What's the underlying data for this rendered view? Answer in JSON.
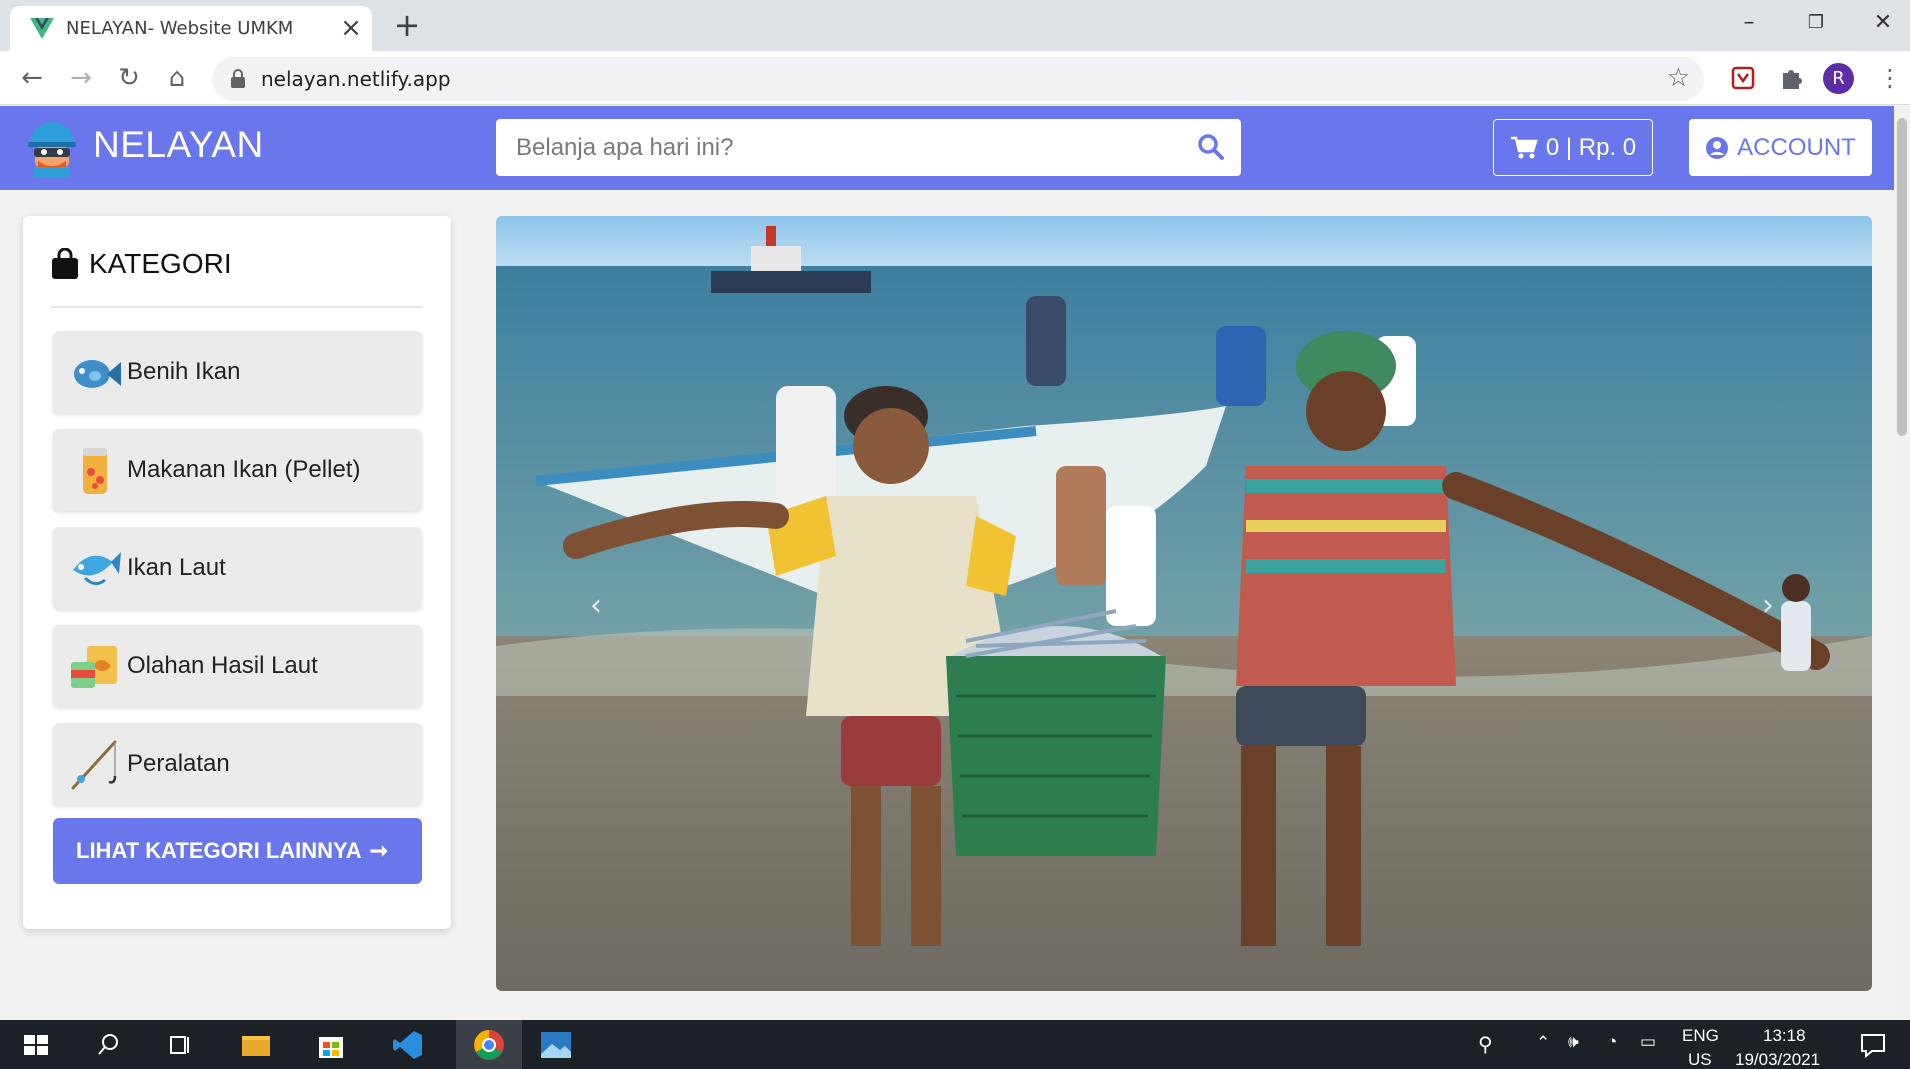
{
  "browser": {
    "tab_title": "NELAYAN- Website UMKM",
    "url": "nelayan.netlify.app",
    "profile_initial": "R"
  },
  "site": {
    "brand": "NELAYAN",
    "search_placeholder": "Belanja apa hari ini?",
    "cart_label": "0 | Rp. 0",
    "account_label": "ACCOUNT",
    "accent_color": "#6a77ec"
  },
  "categories": {
    "title": "KATEGORI",
    "items": [
      {
        "label": "Benih Ikan",
        "icon": "fish-seed-icon"
      },
      {
        "label": "Makanan Ikan (Pellet)",
        "icon": "fish-food-can-icon"
      },
      {
        "label": "Ikan Laut",
        "icon": "sea-fish-icon"
      },
      {
        "label": "Olahan Hasil Laut",
        "icon": "canned-seafood-icon"
      },
      {
        "label": "Peralatan",
        "icon": "fishing-rod-icon"
      }
    ],
    "more_label": "LIHAT KATEGORI LAINNYA"
  },
  "taskbar": {
    "language_top": "ENG",
    "language_bottom": "US",
    "time": "13:18",
    "date": "19/03/2021"
  }
}
